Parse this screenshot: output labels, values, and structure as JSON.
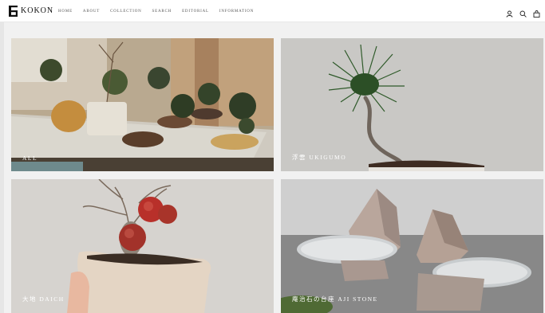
{
  "brand": {
    "name": "KOKON",
    "mark": "ㄎ"
  },
  "nav": {
    "items": [
      {
        "label": "HOME"
      },
      {
        "label": "ABOUT"
      },
      {
        "label": "COLLECTION"
      },
      {
        "label": "SEARCH"
      },
      {
        "label": "EDITORIAL"
      },
      {
        "label": "INFORMATION"
      }
    ]
  },
  "header_icons": [
    "account-icon",
    "search-icon",
    "cart-icon"
  ],
  "collections": [
    {
      "label": "ALL"
    },
    {
      "label": "浮雲 UKIGUMO"
    },
    {
      "label": "大地 DAICH"
    },
    {
      "label": "庵治石の台座 AJI STONE"
    }
  ],
  "colors": {
    "header_bg": "#ffffff",
    "page_bg": "#f1f1f1",
    "caption": "#ffffff"
  }
}
